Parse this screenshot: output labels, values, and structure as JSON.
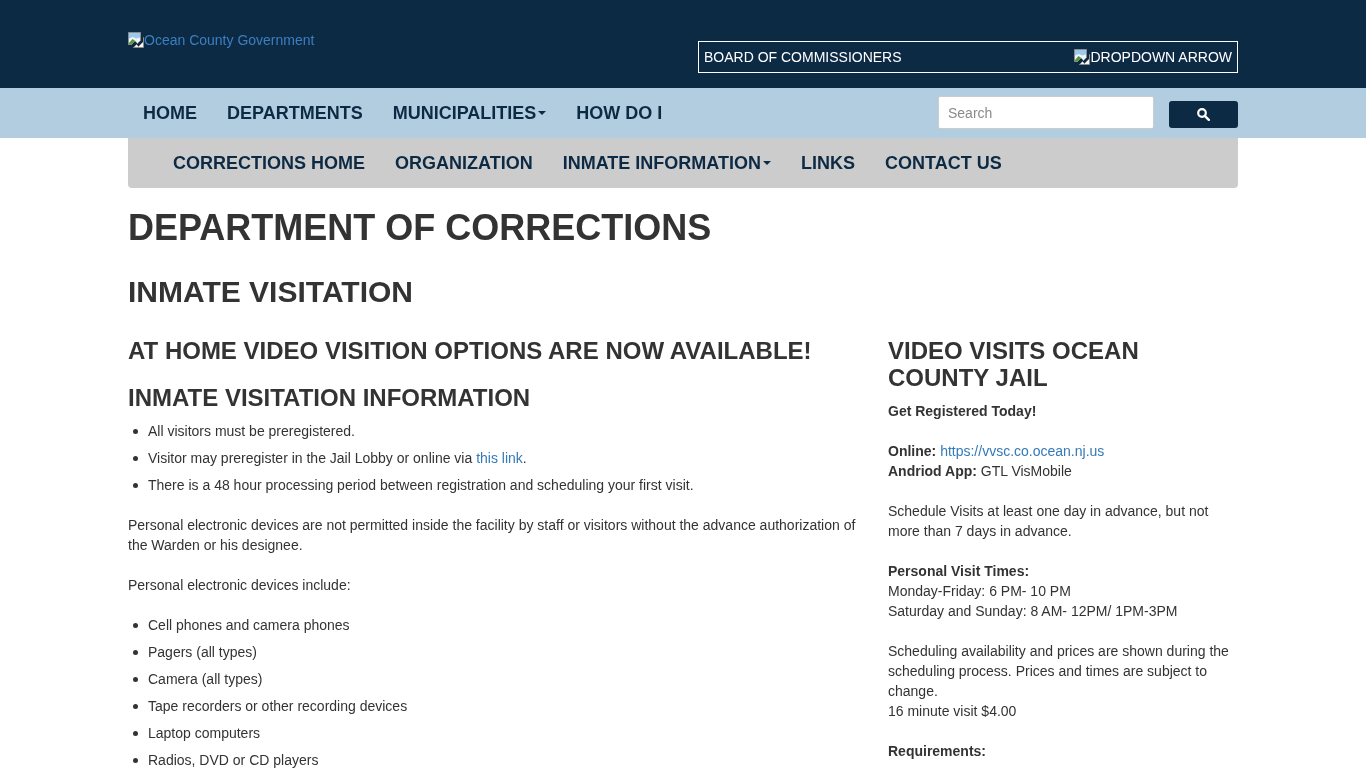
{
  "header": {
    "logo": {
      "alt_text": "Ocean County Government"
    },
    "board_dropdown": {
      "label": "BOARD OF COMMISSIONERS",
      "arrow_alt_text": "DROPDOWN ARROW"
    }
  },
  "main_nav": {
    "items": [
      {
        "label": "HOME",
        "dropdown": false
      },
      {
        "label": "DEPARTMENTS",
        "dropdown": false
      },
      {
        "label": "MUNICIPALITIES",
        "dropdown": true
      },
      {
        "label": "HOW DO I",
        "dropdown": false
      }
    ],
    "search": {
      "placeholder": "Search"
    }
  },
  "sub_nav": {
    "items": [
      {
        "label": "CORRECTIONS HOME",
        "dropdown": false
      },
      {
        "label": "ORGANIZATION",
        "dropdown": false
      },
      {
        "label": "INMATE INFORMATION",
        "dropdown": true
      },
      {
        "label": "LINKS",
        "dropdown": false
      },
      {
        "label": "CONTACT US",
        "dropdown": false
      }
    ]
  },
  "page": {
    "title": "DEPARTMENT OF CORRECTIONS",
    "subtitle": "INMATE VISITATION"
  },
  "main_column": {
    "blocks": [
      {
        "kind": "heading",
        "text": "AT HOME VIDEO VISITION OPTIONS ARE NOW AVAILABLE!"
      },
      {
        "kind": "heading",
        "text": "INMATE VISITATION INFORMATION"
      },
      {
        "kind": "list",
        "items": [
          {
            "text": "All visitors must be preregistered."
          },
          {
            "text": "Visitor may preregister in the Jail Lobby or online via ",
            "link": "this link",
            "text_after": "."
          },
          {
            "text": "There is a 48 hour processing period between registration and scheduling your first visit."
          }
        ]
      },
      {
        "kind": "paragraph",
        "text": "Personal electronic devices are not permitted inside the facility by staff or visitors without the advance authorization of the Warden or his designee."
      },
      {
        "kind": "paragraph",
        "text": "Personal electronic devices include:"
      },
      {
        "kind": "list",
        "items": [
          {
            "text": "Cell phones and camera phones"
          },
          {
            "text": "Pagers (all types)"
          },
          {
            "text": "Camera (all types)"
          },
          {
            "text": "Tape recorders or other recording devices"
          },
          {
            "text": "Laptop computers"
          },
          {
            "text": "Radios, DVD or CD players"
          }
        ]
      }
    ]
  },
  "sidebar": {
    "heading": "VIDEO VISITS OCEAN COUNTY JAIL",
    "paragraphs": [
      {
        "lines": [
          {
            "kind": "strong",
            "text": "Get Registered Today!"
          }
        ]
      },
      {
        "lines": [
          {
            "kind": "link",
            "label": "Online:",
            "text": "https://vvsc.co.ocean.nj.us"
          },
          {
            "kind": "plain",
            "label": "Andriod App:",
            "text": "GTL VisMobile"
          }
        ]
      },
      {
        "lines": [
          {
            "kind": "plain",
            "text": "Schedule Visits at least one day in advance, but not more than 7 days in advance."
          }
        ]
      },
      {
        "lines": [
          {
            "kind": "strong",
            "text": "Personal Visit Times:"
          },
          {
            "kind": "plain",
            "text": "Monday-Friday: 6 PM- 10 PM"
          },
          {
            "kind": "plain",
            "text": "Saturday and Sunday: 8 AM- 12PM/ 1PM-3PM"
          }
        ]
      },
      {
        "lines": [
          {
            "kind": "plain",
            "text": "Scheduling availability and prices are shown during the scheduling process. Prices and times are subject to change."
          },
          {
            "kind": "plain",
            "text": "16 minute visit $4.00"
          }
        ]
      },
      {
        "lines": [
          {
            "kind": "strong",
            "text": "Requirements:"
          }
        ]
      }
    ]
  }
}
